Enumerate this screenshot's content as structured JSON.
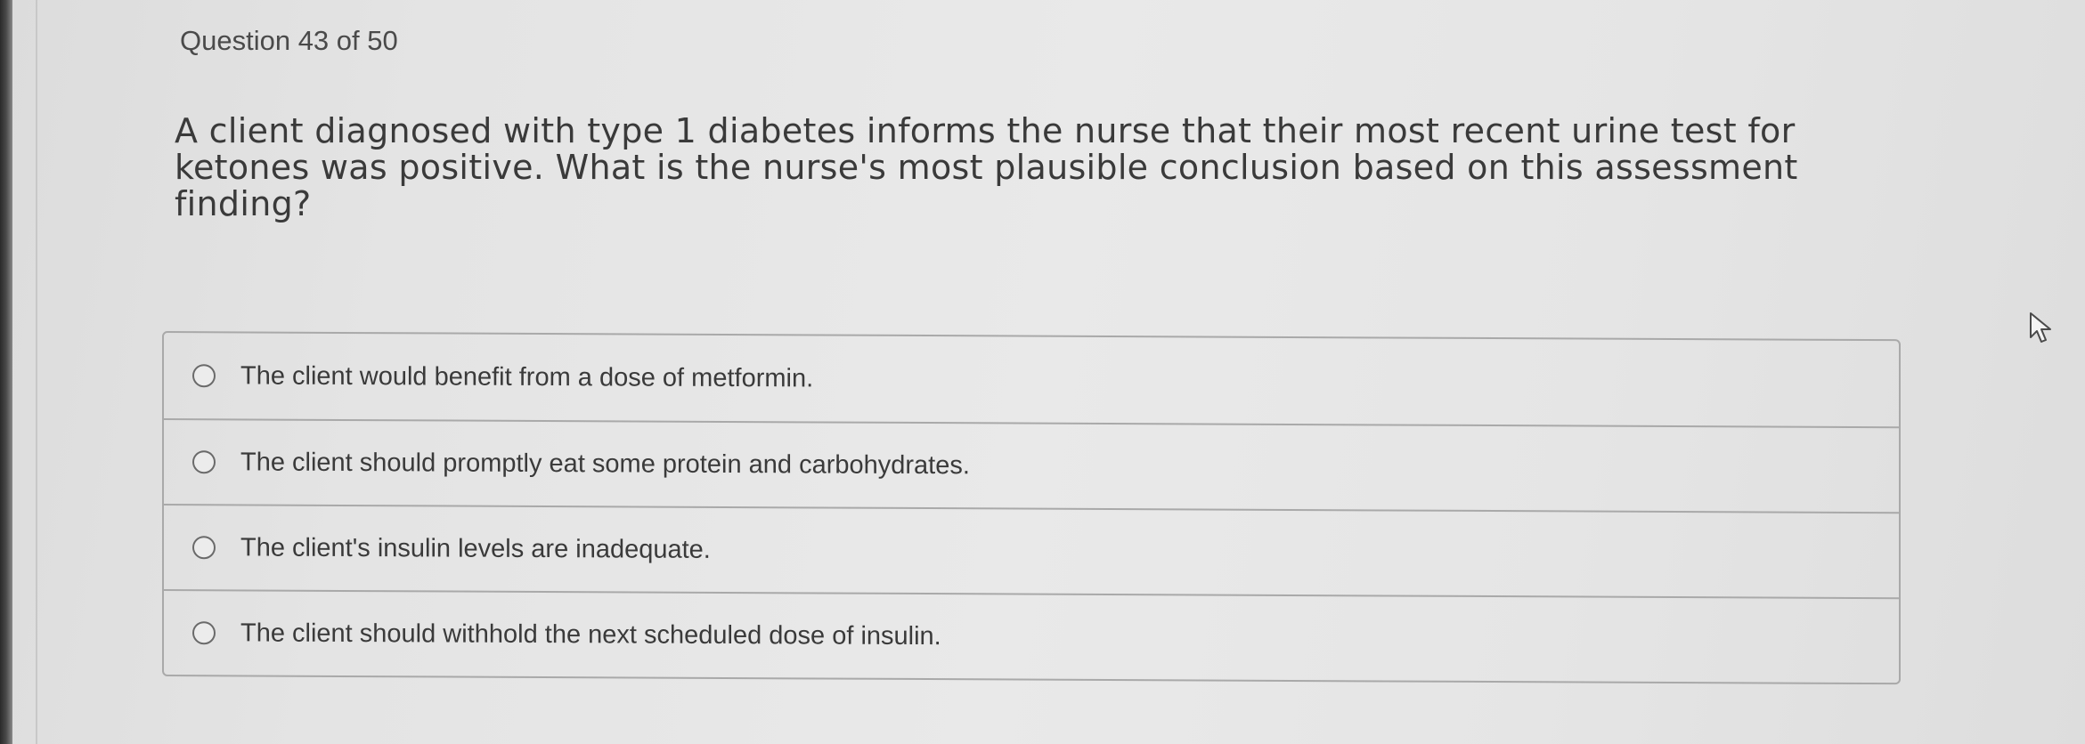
{
  "quiz": {
    "counter": "Question 43 of 50",
    "question": "A client diagnosed with type 1 diabetes informs the nurse that their most recent urine test for ketones was positive. What is the nurse's most plausible conclusion based on this assessment finding?",
    "options": [
      {
        "label": "The client would benefit from a dose of metformin."
      },
      {
        "label": "The client should promptly eat some protein and carbohydrates."
      },
      {
        "label": "The client's insulin levels are inadequate."
      },
      {
        "label": "The client should withhold the next scheduled dose of insulin."
      }
    ]
  },
  "icons": {
    "radio": "radio-unselected-icon",
    "cursor": "mouse-pointer-icon"
  }
}
